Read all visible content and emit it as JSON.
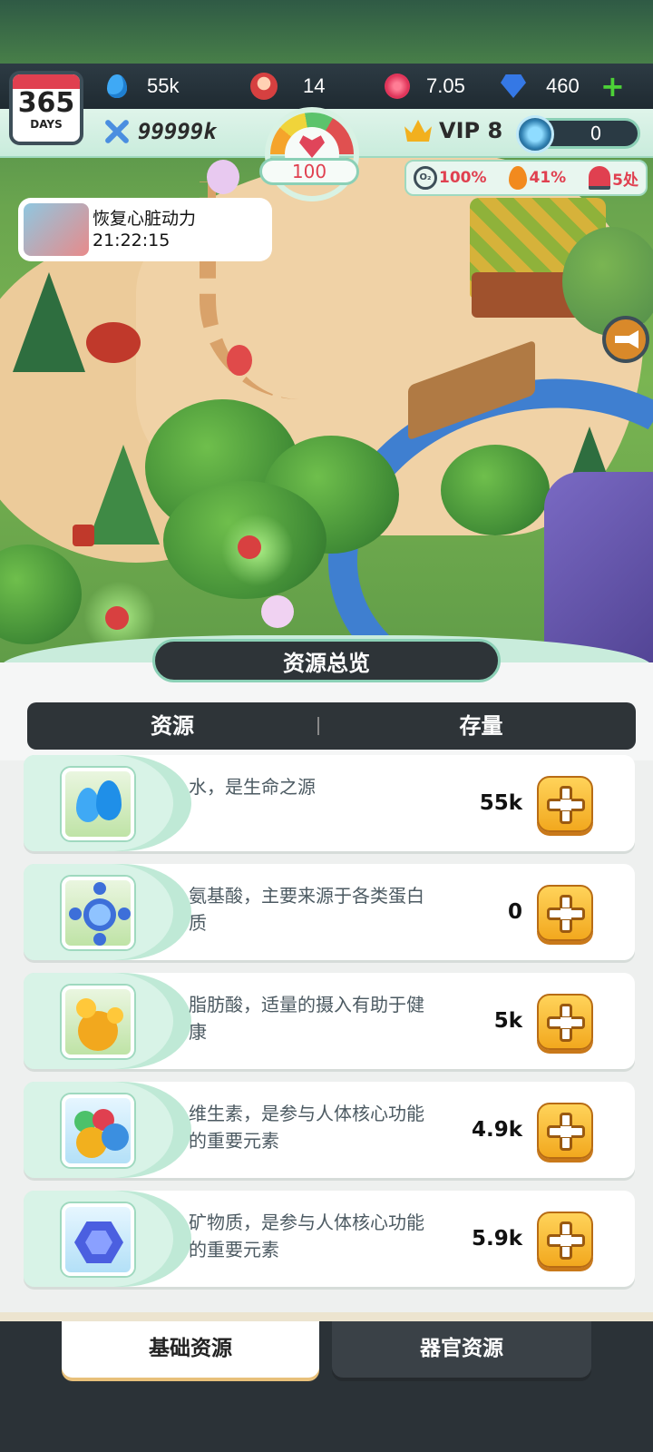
{
  "hud": {
    "calendar": {
      "number": "365",
      "unit": "DAYS",
      "icon": "calendar-icon"
    },
    "water": {
      "icon": "water-drop-icon",
      "value": "55k"
    },
    "heroes": {
      "icon": "hero-portrait-icon",
      "value": "14"
    },
    "berries": {
      "icon": "berry-icon",
      "value": "7.05"
    },
    "gems": {
      "icon": "diamond-icon",
      "value": "460"
    },
    "add_currency": "+",
    "power": {
      "icon": "crossed-swords-icon",
      "value": "99999k"
    },
    "vip": {
      "icon": "crown-icon",
      "label": "VIP 8"
    },
    "timer": {
      "icon": "clock-icon",
      "value": "0"
    },
    "gauge": {
      "icon": "heart-icon",
      "value": "100",
      "level": 100
    }
  },
  "stats": {
    "oxygen": {
      "icon": "oxygen-icon",
      "value": "100%"
    },
    "fire": {
      "icon": "fire-icon",
      "value": "41%"
    },
    "alert": {
      "icon": "siren-icon",
      "value": "5处"
    }
  },
  "task": {
    "title": "恢复心脏动力",
    "time": "21:22:15"
  },
  "panel": {
    "title": "资源总览",
    "col_resource": "资源",
    "col_stock": "存量"
  },
  "resources": [
    {
      "icon": "water-drops-icon",
      "desc": "水，是生命之源",
      "value": "55k",
      "color": "#3fa9f5"
    },
    {
      "icon": "amino-acid-icon",
      "desc": "氨基酸，主要来源于各类蛋白质",
      "value": "0",
      "color": "#3d6fd9"
    },
    {
      "icon": "fatty-acid-icon",
      "desc": "脂肪酸，适量的摄入有助于健康",
      "value": "5k",
      "color": "#f2a81e"
    },
    {
      "icon": "vitamin-icon",
      "desc": "维生素，是参与人体核心功能的重要元素",
      "value": "4.9k",
      "color": "#4aa8e8"
    },
    {
      "icon": "mineral-icon",
      "desc": "矿物质，是参与人体核心功能的重要元素",
      "value": "5.9k",
      "color": "#4b5fe0"
    }
  ],
  "tabs": {
    "basic": "基础资源",
    "organ": "器官资源"
  }
}
